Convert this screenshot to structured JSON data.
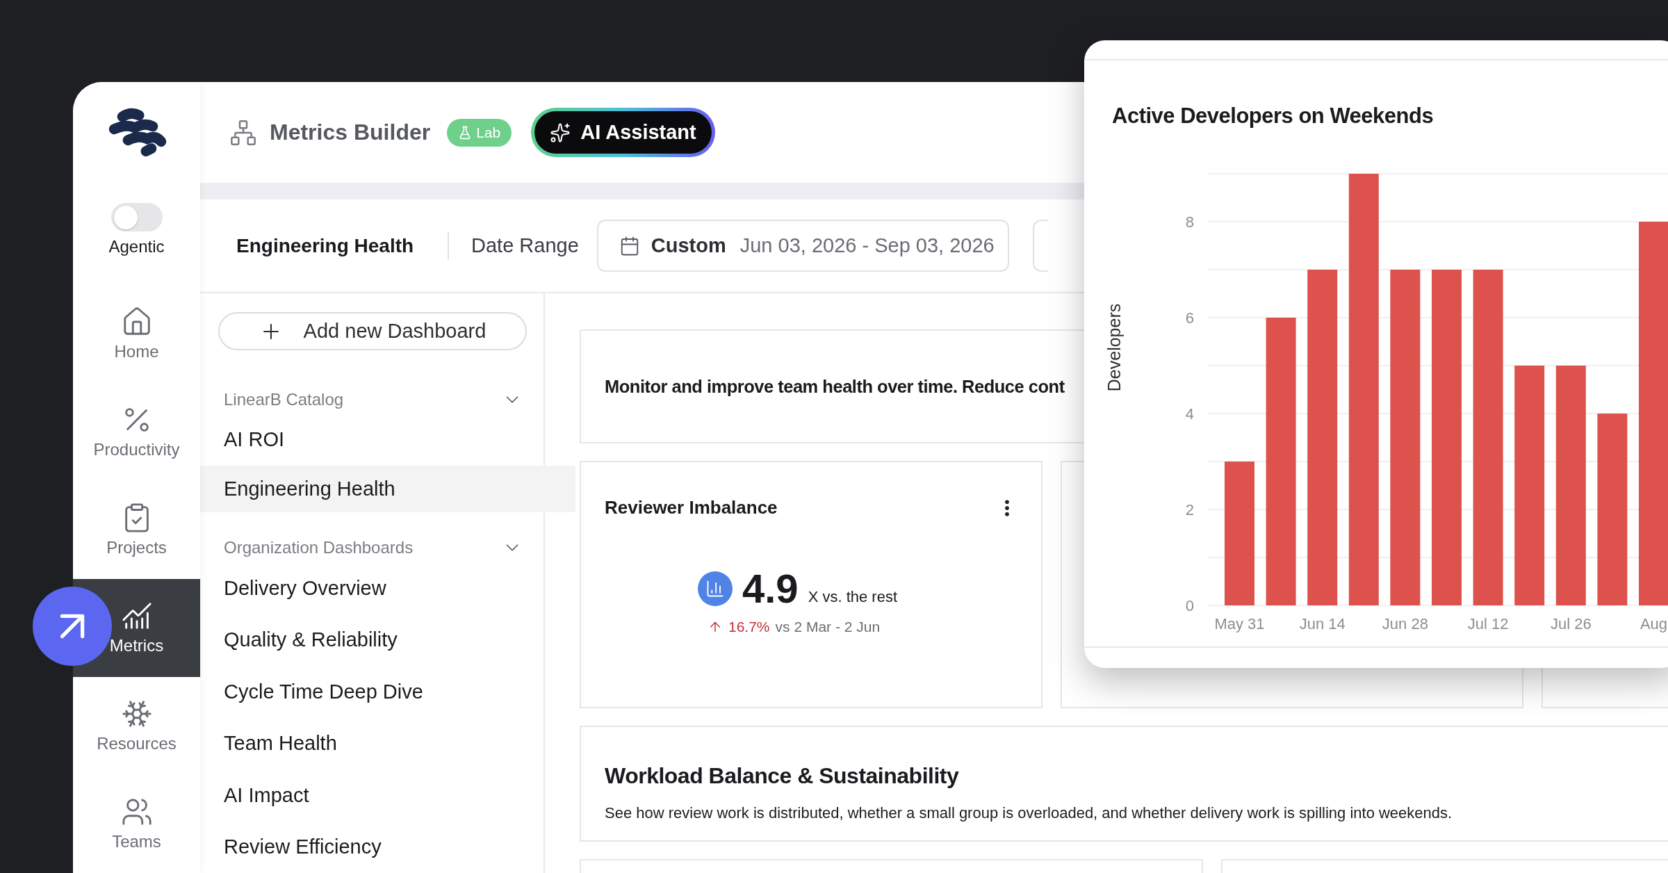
{
  "rail": {
    "toggle": {
      "label": "Agentic",
      "on": false
    },
    "items": [
      {
        "label": "Home",
        "selected": false
      },
      {
        "label": "Productivity",
        "selected": false
      },
      {
        "label": "Projects",
        "selected": false
      },
      {
        "label": "Metrics",
        "selected": true
      },
      {
        "label": "Resources",
        "selected": false
      },
      {
        "label": "Teams",
        "selected": false
      }
    ]
  },
  "header": {
    "title": "Metrics Builder",
    "badge": "Lab",
    "ai_button": "AI Assistant"
  },
  "filters": {
    "dashboard": "Engineering Health",
    "date_label": "Date Range",
    "date_mode": "Custom",
    "date_value": "Jun 03, 2026 - Sep 03, 2026"
  },
  "dashboard_list": {
    "add_button": "Add new Dashboard",
    "sections": [
      {
        "title": "LinearB Catalog",
        "expanded": true,
        "items": [
          {
            "label": "AI ROI",
            "selected": false
          },
          {
            "label": "Engineering Health",
            "selected": true
          }
        ]
      },
      {
        "title": "Organization Dashboards",
        "expanded": true,
        "items": [
          {
            "label": "Delivery Overview",
            "selected": false
          },
          {
            "label": "Quality & Reliability",
            "selected": false
          },
          {
            "label": "Cycle Time Deep Dive",
            "selected": false
          },
          {
            "label": "Team Health",
            "selected": false
          },
          {
            "label": "AI Impact",
            "selected": false
          },
          {
            "label": "Review Efficiency",
            "selected": false
          }
        ]
      }
    ]
  },
  "content": {
    "intro": "Monitor and improve team health over time. Reduce cont",
    "metric_card": {
      "title": "Reviewer Imbalance",
      "value": "4.9",
      "unit": "X vs. the rest",
      "change": "16.7%",
      "comparison": "vs 2 Mar - 2 Jun"
    },
    "section": {
      "title": "Workload Balance & Sustainability",
      "description": "See how review work is distributed, whether a small group is overloaded, and whether delivery work is spilling into weekends."
    }
  },
  "chart_panel": {
    "title": "Active Developers on Weekends",
    "chart_data": {
      "type": "bar",
      "ylabel": "Developers",
      "categories": [
        "May 31",
        null,
        "Jun 14",
        null,
        "Jun 28",
        null,
        "Jul 12",
        null,
        "Jul 26",
        null,
        "Aug"
      ],
      "series": [
        {
          "color": "#dd524d",
          "values": [
            3,
            6,
            7,
            9,
            7,
            7,
            7,
            5,
            5,
            4,
            8
          ]
        }
      ],
      "ylim": [
        0,
        9
      ],
      "yticks": [
        0,
        2,
        4,
        6,
        8
      ],
      "grid": true
    }
  }
}
